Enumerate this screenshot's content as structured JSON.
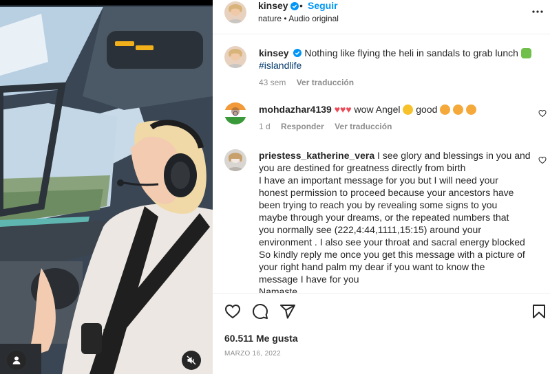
{
  "post": {
    "username": "kinsey",
    "follow_label": "Seguir",
    "separator": "•",
    "subtitle": "nature • Audio original",
    "more_icon": "more-horizontal-icon"
  },
  "caption": {
    "username": "kinsey",
    "text": "Nothing like flying the heli in sandals to grab lunch",
    "hashtag": "#islandlife",
    "age": "43 sem",
    "translate_label": "Ver traducción"
  },
  "comments": [
    {
      "username": "mohdazhar4139",
      "text": "wow Angel",
      "text2": "good",
      "age": "1 d",
      "reply_label": "Responder",
      "translate_label": "Ver traducción"
    },
    {
      "username": "priestess_katherine_vera",
      "lines": [
        "I see glory and blessings in you and",
        "you are destined for greatness directly from birth",
        "I have an important message for you but I will need your",
        "honest permission to proceed because your ancestors have",
        "been trying to reach you by revealing some signs to you",
        "maybe through your dreams, or the repeated numbers that",
        "you normally see (222,4:44,1111,15:15) around your",
        "environment . I also see your throat and sacral energy blocked",
        "So kindly reply me once you get this message with a picture of",
        "your right hand palm my dear if you want to know the",
        "message I have for you",
        "Namaste"
      ]
    }
  ],
  "footer": {
    "likes": "60.511 Me gusta",
    "date": "MARZO 16, 2022"
  },
  "colors": {
    "accent": "#0095f6",
    "heart_red": "#ed4956",
    "muted": "#8e8e8e"
  }
}
